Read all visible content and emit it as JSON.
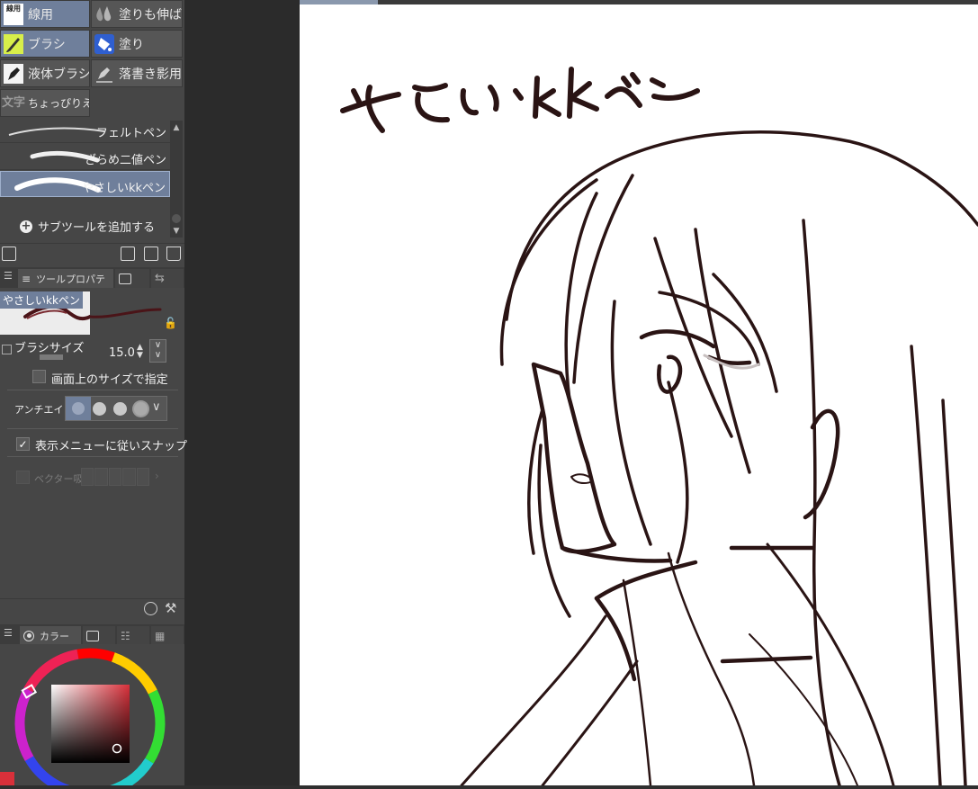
{
  "tools": [
    {
      "label": "線用",
      "icon": "brush-set-icon",
      "selected": true
    },
    {
      "label": "塗りも伸ばし",
      "icon": "water-drops-icon",
      "selected": false
    },
    {
      "label": "ブラシ",
      "icon": "brush-icon",
      "selected": true
    },
    {
      "label": "塗り",
      "icon": "fill-bucket-icon",
      "selected": false
    },
    {
      "label": "液体ブラシ",
      "icon": "pen-icon",
      "selected": false
    },
    {
      "label": "落書き影用",
      "icon": "scribble-pen-icon",
      "selected": false
    },
    {
      "label": "ちょっぴりえ",
      "icon": "text-icon",
      "selected": false
    }
  ],
  "tool_icon_text": {
    "brush_set": "線用",
    "text": "文字"
  },
  "subtools": [
    {
      "name": "フェルトペン",
      "selected": false
    },
    {
      "name": "ざらめ二値ペン",
      "selected": false
    },
    {
      "name": "やさしいkkペン",
      "selected": true
    }
  ],
  "add_subtool": "サブツールを追加する",
  "tool_property": {
    "tab_label": "ツールプロパテ",
    "preview_name": "やさしいkkペン",
    "brush_size_label": "ブラシサイズ",
    "brush_size_value": "15.0",
    "screen_size_label": "画面上のサイズで指定",
    "screen_size_checked": false,
    "antialias_label": "アンチエイリ",
    "antialias_level": 0,
    "snap_label": "表示メニューに従いスナップ",
    "snap_checked": true,
    "vector_label": "ベクター吸"
  },
  "color_panel": {
    "tab_label": "カラー",
    "main_color": "#d8303a"
  },
  "canvas": {
    "handwritten_title": "やさしいkkペン",
    "stroke_color": "#2a1414"
  },
  "colors": {
    "panel": "#464646",
    "selected": "#6f7f9b",
    "canvas": "#ffffff"
  }
}
